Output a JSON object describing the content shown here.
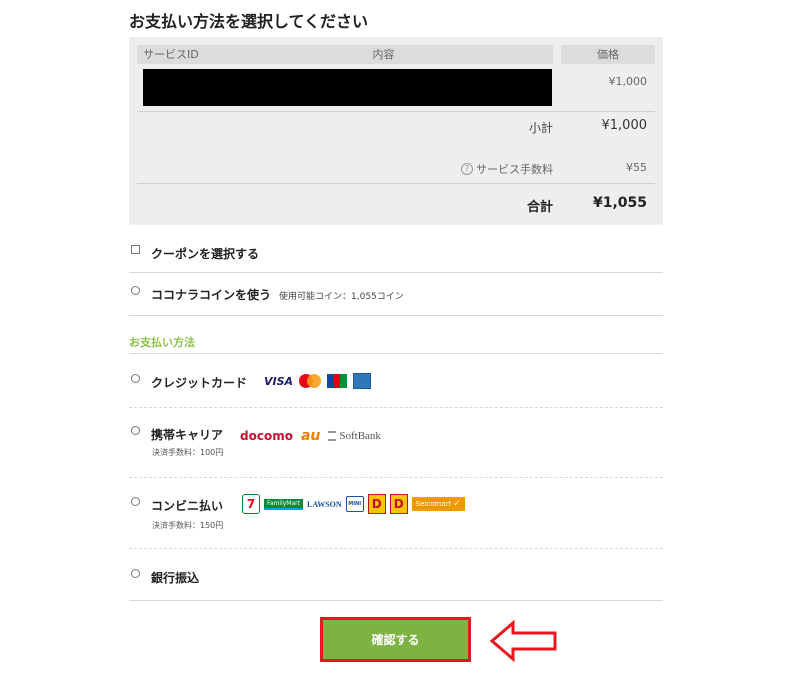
{
  "page": {
    "title": "お支払い方法を選択してください"
  },
  "summary": {
    "headers": {
      "service_id": "サービスID",
      "content": "内容",
      "price": "価格"
    },
    "item_price": "¥1,000",
    "subtotal_label": "小計",
    "subtotal_value": "¥1,000",
    "fee_label": "サービス手数料",
    "fee_value": "¥55",
    "total_label": "合計",
    "total_value": "¥1,055"
  },
  "options": {
    "coupon_label": "クーポンを選択する",
    "coin_label": "ココナラコインを使う",
    "coin_note": "使用可能コイン：1,055コイン"
  },
  "payment": {
    "section_title": "お支払い方法",
    "methods": [
      {
        "label": "クレジットカード",
        "fee": "",
        "logos": [
          "VISA",
          "mastercard-icon",
          "jcb-icon",
          "amex-icon"
        ]
      },
      {
        "label": "携帯キャリア",
        "fee": "決済手数料：100円",
        "logos": [
          "docomo",
          "au",
          "SoftBank"
        ]
      },
      {
        "label": "コンビニ払い",
        "fee": "決済手数料：150円",
        "logos": [
          "seven-eleven-icon",
          "FamilyMart",
          "LAWSON",
          "ministop-icon",
          "daily-yamazaki-icon",
          "yamazaki-icon",
          "Seicomart"
        ]
      },
      {
        "label": "銀行振込",
        "fee": ""
      }
    ]
  },
  "actions": {
    "confirm_label": "確認する"
  },
  "colors": {
    "accent_green": "#7cb342",
    "section_green": "#8bc34a",
    "highlight_red": "#e8171f"
  }
}
